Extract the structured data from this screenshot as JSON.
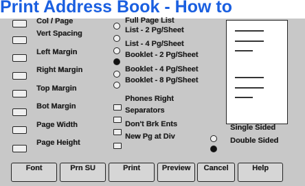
{
  "page_title": "Print Address Book - How to",
  "left_fields": [
    "Col / Page",
    "Vert Spacing",
    "Left Margin",
    "Right Margin",
    "Top Margin",
    "Bot Margin",
    "Page Width",
    "Page Height"
  ],
  "layout_heading": "Full Page List",
  "layout_options": [
    "List - 2 Pg/Sheet",
    "List - 4 Pg/Sheet",
    "Booklet - 2 Pg/Sheet",
    "Booklet - 4 Pg/Sheet",
    "Booklet - 8 Pg/Sheet"
  ],
  "layout_selected": "Booklet - 2 Pg/Sheet",
  "check_options": [
    "Phones Right",
    "Separators",
    "Don't Brk Ents",
    "New Pg at Div"
  ],
  "sided": {
    "single": "Single Sided",
    "double": "Double Sided",
    "selected": "Double Sided"
  },
  "buttons": {
    "font": "Font",
    "prn_su": "Prn SU",
    "print": "Print",
    "preview": "Preview",
    "cancel": "Cancel",
    "help": "Help"
  }
}
